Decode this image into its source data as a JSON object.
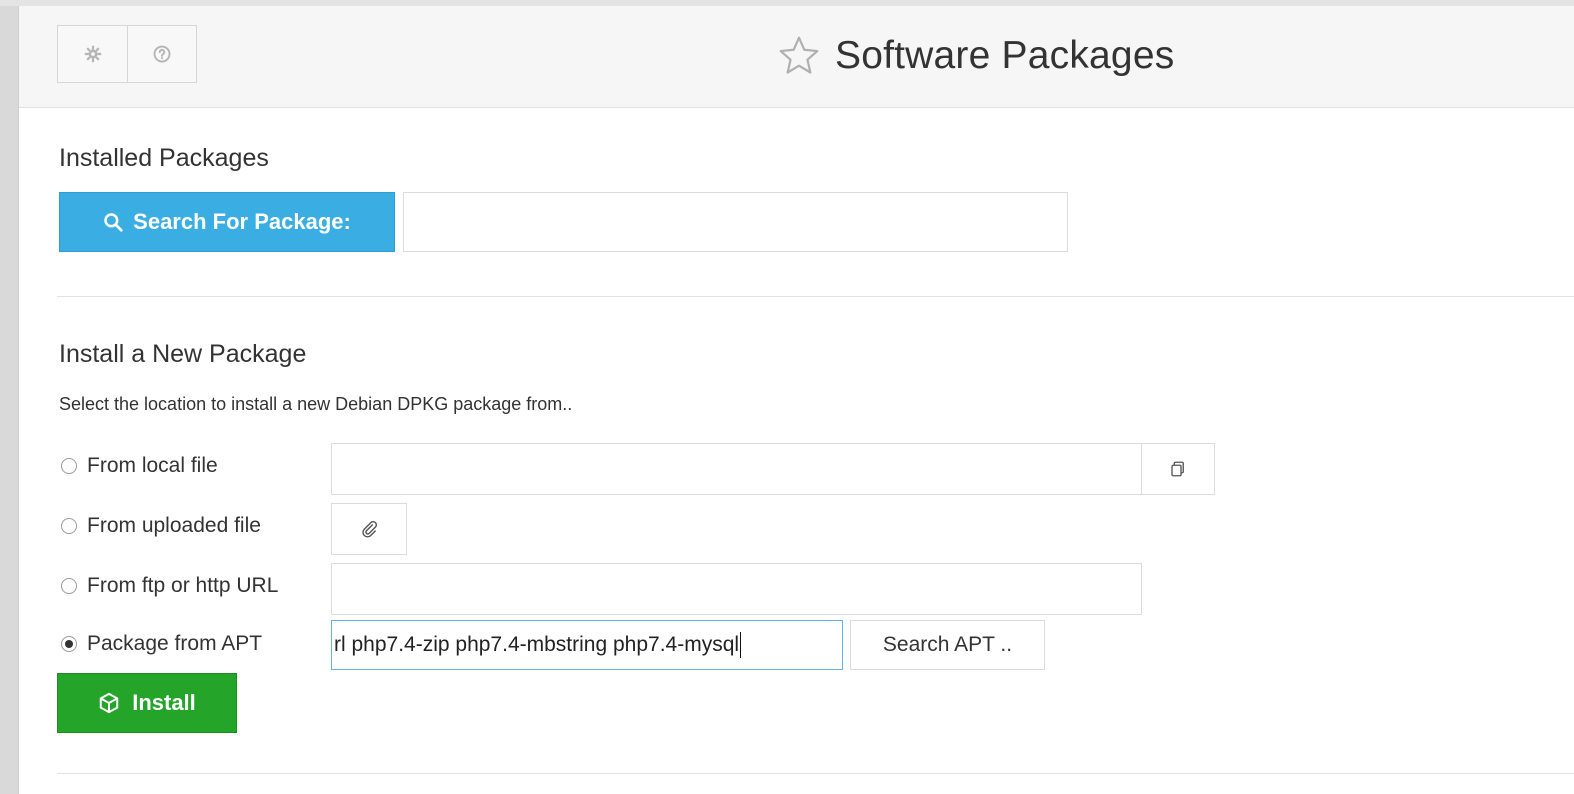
{
  "header": {
    "title": "Software Packages",
    "buttons": [
      {
        "icon": "gear-icon"
      },
      {
        "icon": "help-icon"
      }
    ],
    "star_icon": "star-outline-icon"
  },
  "installed": {
    "title": "Installed Packages",
    "search_button_label": "Search For Package:",
    "search_icon": "search-icon",
    "search_value": ""
  },
  "install_new": {
    "title": "Install a New Package",
    "description": "Select the location to install a new Debian DPKG package from..",
    "options": [
      {
        "label": "From local file",
        "checked": false
      },
      {
        "label": "From uploaded file",
        "checked": false
      },
      {
        "label": "From ftp or http URL",
        "checked": false
      },
      {
        "label": "Package from APT",
        "checked": true
      }
    ],
    "local_file_value": "",
    "url_value": "",
    "apt_value": "rl php7.4-zip php7.4-mbstring php7.4-mysql",
    "search_apt_label": "Search APT ..",
    "install_label": "Install"
  },
  "colors": {
    "search_button": "#3aaee3",
    "install_button": "#24a52a",
    "focus_border": "#66afe9"
  }
}
